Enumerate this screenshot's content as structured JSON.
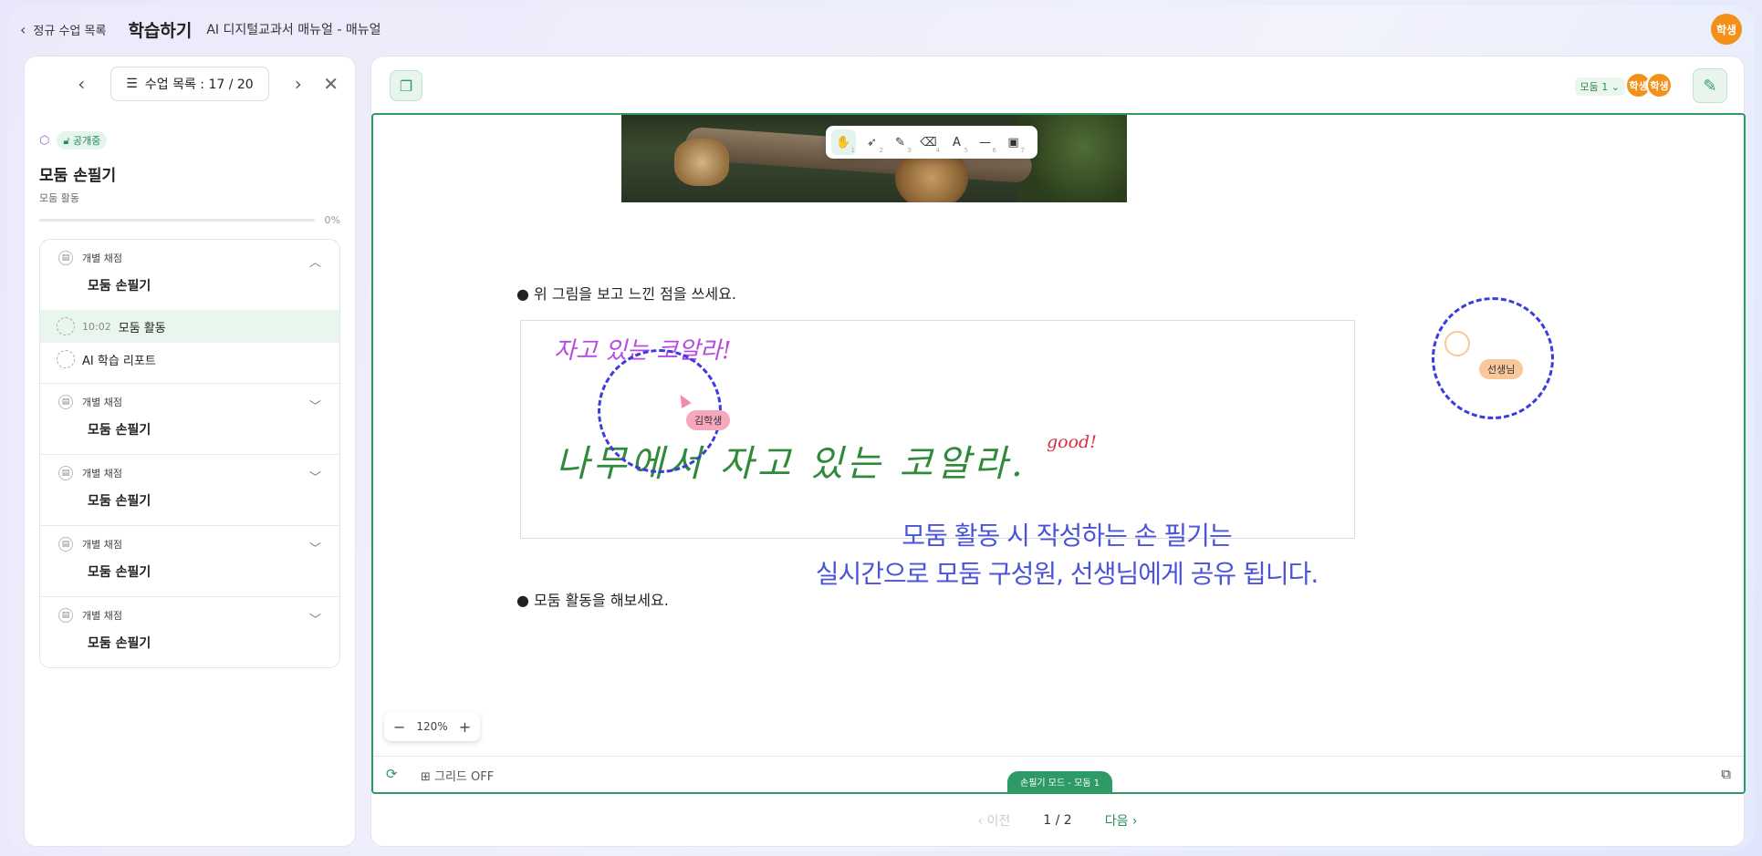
{
  "header": {
    "back_label": "정규 수업 목록",
    "title": "학습하기",
    "subtitle": "AI 디지털교과서 매뉴얼 - 매뉴얼",
    "user_badge": "학생"
  },
  "left_panel": {
    "lesson_nav": "수업 목록 : 17 / 20",
    "public_badge": "공개중",
    "activity_title": "모둠 손필기",
    "activity_sub": "모둠 활동",
    "progress_label": "0%",
    "progress_value": 0,
    "groups": [
      {
        "meta": "개별 채점",
        "name": "모둠 손필기",
        "expanded": true,
        "items": [
          {
            "time": "10:02",
            "label": "모둠 활동",
            "active": true
          },
          {
            "time": "",
            "label": "AI 학습 리포트",
            "active": false
          }
        ]
      },
      {
        "meta": "개별 채점",
        "name": "모둠 손필기",
        "expanded": false,
        "items": []
      },
      {
        "meta": "개별 채점",
        "name": "모둠 손필기",
        "expanded": false,
        "items": []
      },
      {
        "meta": "개별 채점",
        "name": "모둠 손필기",
        "expanded": false,
        "items": []
      },
      {
        "meta": "개별 채점",
        "name": "모둠 손필기",
        "expanded": false,
        "items": []
      }
    ]
  },
  "main": {
    "group_selector": "모둠 1",
    "avatars": [
      "학생",
      "학생"
    ],
    "toolbar": [
      {
        "icon": "hand-icon",
        "glyph": "✋",
        "key": "1"
      },
      {
        "icon": "select-icon",
        "glyph": "➶",
        "key": "2"
      },
      {
        "icon": "pen-icon",
        "glyph": "✎",
        "key": "3"
      },
      {
        "icon": "eraser-icon",
        "glyph": "⌫",
        "key": "4"
      },
      {
        "icon": "text-icon",
        "glyph": "A",
        "key": "5"
      },
      {
        "icon": "line-icon",
        "glyph": "—",
        "key": "6"
      },
      {
        "icon": "image-icon",
        "glyph": "▣",
        "key": "7"
      }
    ],
    "question1": "● 위 그림을 보고 느낀 점을 쓰세요.",
    "question2": "● 모둠 활동을 해보세요.",
    "handwriting": {
      "purple": "자고 있는 코알라!",
      "green": "나무에서 자고 있는 코알라.",
      "red": "good!"
    },
    "cursor_tags": {
      "student": "김학생",
      "teacher": "선생님"
    },
    "caption_line1": "모둠 활동 시 작성하는 손 필기는",
    "caption_line2": "실시간으로 모둠 구성원, 선생님에게 공유 됩니다.",
    "zoom_level": "120%",
    "grid_toggle": "그리드 OFF",
    "mode_badge": "손필기 모드 - 모둠 1",
    "pager": {
      "prev": "이전",
      "page": "1 / 2",
      "next": "다음"
    }
  },
  "colors": {
    "accent": "#2e9a66",
    "caption": "#4a54d6",
    "avatar": "#f39019"
  }
}
